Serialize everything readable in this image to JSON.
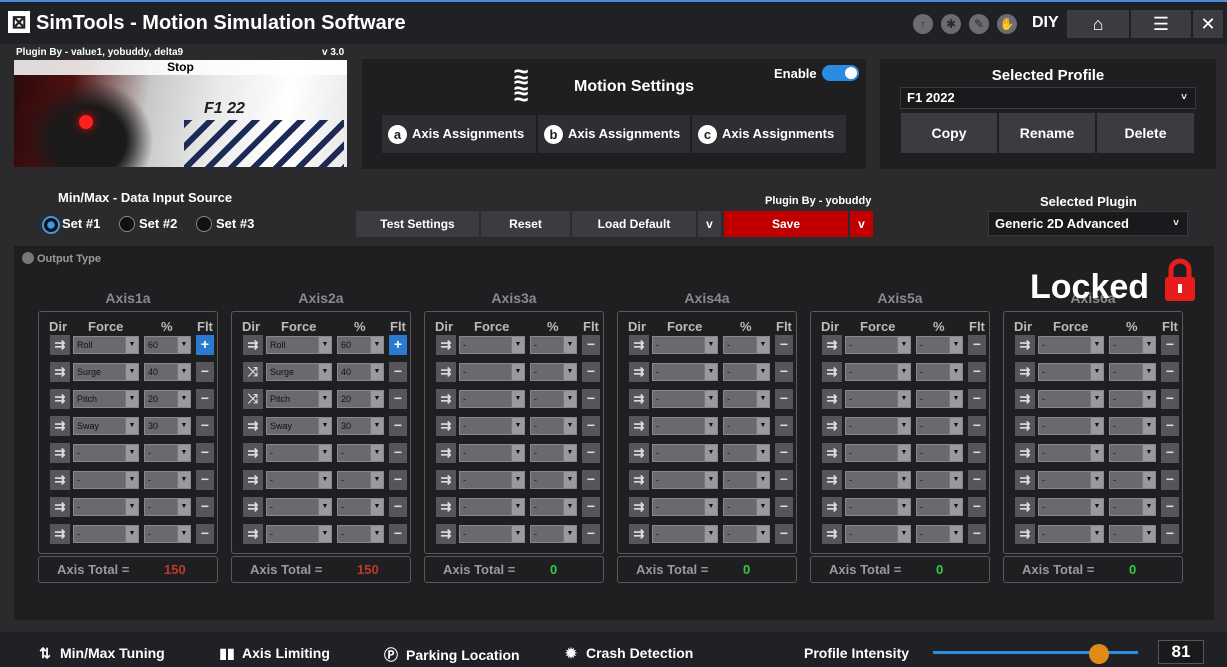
{
  "app": {
    "title": "SimTools - Motion Simulation Software",
    "logo_glyph": "⊠",
    "mode": "DIY"
  },
  "titlebar_icons": [
    "upload-icon",
    "gear-icon",
    "wrench-icon",
    "hand-icon"
  ],
  "plugin": {
    "by": "Plugin By - value1, yobuddy, delta9",
    "version": "v 3.0",
    "stop_label": "Stop",
    "game_logo": "F1 22"
  },
  "motion": {
    "title": "Motion Settings",
    "enable_label": "Enable",
    "enabled": true,
    "axis_buttons": [
      {
        "letter": "a",
        "label": "Axis Assignments"
      },
      {
        "letter": "b",
        "label": "Axis Assignments"
      },
      {
        "letter": "c",
        "label": "Axis Assignments"
      }
    ]
  },
  "profile": {
    "title": "Selected Profile",
    "value": "F1 2022",
    "copy": "Copy",
    "rename": "Rename",
    "delete": "Delete"
  },
  "minmax": {
    "label": "Min/Max - Data Input Source",
    "sets": [
      "Set #1",
      "Set #2",
      "Set #3"
    ],
    "selected": "Set #1"
  },
  "actions": {
    "test": "Test Settings",
    "reset": "Reset",
    "load_default": "Load Default",
    "v": "v",
    "save_by": "Plugin By - yobuddy",
    "save": "Save"
  },
  "selected_plugin": {
    "title": "Selected Plugin",
    "value": "Generic 2D Advanced"
  },
  "output_type": "Output Type",
  "locked": "Locked",
  "headers": {
    "dir": "Dir",
    "force": "Force",
    "pct": "%",
    "flt": "Flt"
  },
  "total_label": "Axis Total =",
  "axes": [
    {
      "title": "Axis1a",
      "total": "150",
      "rows": [
        {
          "dir": "⇉",
          "force": "Roll",
          "pct": "60",
          "flt": "+"
        },
        {
          "dir": "⇉",
          "force": "Surge",
          "pct": "40",
          "flt": "−"
        },
        {
          "dir": "⇉",
          "force": "Pitch",
          "pct": "20",
          "flt": "−"
        },
        {
          "dir": "⇉",
          "force": "Sway",
          "pct": "30",
          "flt": "−"
        },
        {
          "dir": "⇉",
          "force": "-",
          "pct": "-",
          "flt": "−"
        },
        {
          "dir": "⇉",
          "force": "-",
          "pct": "-",
          "flt": "−"
        },
        {
          "dir": "⇉",
          "force": "-",
          "pct": "-",
          "flt": "−"
        },
        {
          "dir": "⇉",
          "force": "-",
          "pct": "-",
          "flt": "−"
        }
      ]
    },
    {
      "title": "Axis2a",
      "total": "150",
      "rows": [
        {
          "dir": "⇉",
          "force": "Roll",
          "pct": "60",
          "flt": "+"
        },
        {
          "dir": "⤨",
          "force": "Surge",
          "pct": "40",
          "flt": "−"
        },
        {
          "dir": "⤨",
          "force": "Pitch",
          "pct": "20",
          "flt": "−"
        },
        {
          "dir": "⇉",
          "force": "Sway",
          "pct": "30",
          "flt": "−"
        },
        {
          "dir": "⇉",
          "force": "-",
          "pct": "-",
          "flt": "−"
        },
        {
          "dir": "⇉",
          "force": "-",
          "pct": "-",
          "flt": "−"
        },
        {
          "dir": "⇉",
          "force": "-",
          "pct": "-",
          "flt": "−"
        },
        {
          "dir": "⇉",
          "force": "-",
          "pct": "-",
          "flt": "−"
        }
      ]
    },
    {
      "title": "Axis3a",
      "total": "0",
      "rows": "empty"
    },
    {
      "title": "Axis4a",
      "total": "0",
      "rows": "empty"
    },
    {
      "title": "Axis5a",
      "total": "0",
      "rows": "empty"
    },
    {
      "title": "Axis6a",
      "total": "0",
      "rows": "empty"
    }
  ],
  "footer": {
    "tuning": "Min/Max Tuning",
    "limiting": "Axis Limiting",
    "parking": "Parking Location",
    "crash": "Crash Detection",
    "intensity_label": "Profile Intensity",
    "intensity": "81"
  },
  "colors": {
    "accent": "#2a8ce0",
    "save": "#c00000",
    "total_red": "#c0392b",
    "total_green": "#2ecc40",
    "knob": "#e08a1a"
  }
}
